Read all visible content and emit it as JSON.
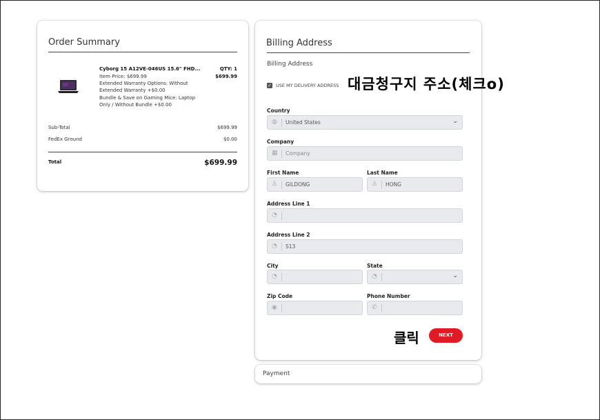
{
  "order_summary": {
    "title": "Order Summary",
    "product_name": "Cyborg 15 A12VE-046US 15.6\" FHD...",
    "item_price": "Item Price: $699.99",
    "warranty_line1": "Extended Warranty Options: Without",
    "warranty_line2": "Extended Warranty +$0.00",
    "bundle_line1": "Bundle & Save on Gaming Mice: Laptop",
    "bundle_line2": "Only / Without Bundle +$0.00",
    "qty": "QTY: 1",
    "line_price": "$699.99",
    "subtotal_label": "Sub-Total",
    "subtotal_value": "$699.99",
    "shipping_label": "FedEx Ground",
    "shipping_value": "$0.00",
    "total_label": "Total",
    "total_value": "$699.99"
  },
  "billing": {
    "title": "Billing Address",
    "subtitle": "Billing Address",
    "use_delivery_label": "USE MY DELIVERY ADDRESS",
    "country_label": "Country",
    "country_value": "United States",
    "company_label": "Company",
    "company_placeholder": "Company",
    "first_name_label": "First Name",
    "first_name_value": "GILDONG",
    "last_name_label": "Last Name",
    "last_name_value": "HONG",
    "address1_label": "Address Line 1",
    "address1_value": "",
    "address2_label": "Address Line 2",
    "address2_value": "S13",
    "city_label": "City",
    "city_value": "",
    "state_label": "State",
    "state_value": "",
    "zip_label": "Zip Code",
    "zip_value": "",
    "phone_label": "Phone Number",
    "phone_value": "",
    "next_label": "NEXT"
  },
  "payment": {
    "title": "Payment"
  },
  "annotations": {
    "check_note": "대금청구지 주소(체크o)",
    "click_note": "클릭"
  },
  "colors": {
    "accent": "#e01b24",
    "field_bg": "#e8eaed"
  }
}
